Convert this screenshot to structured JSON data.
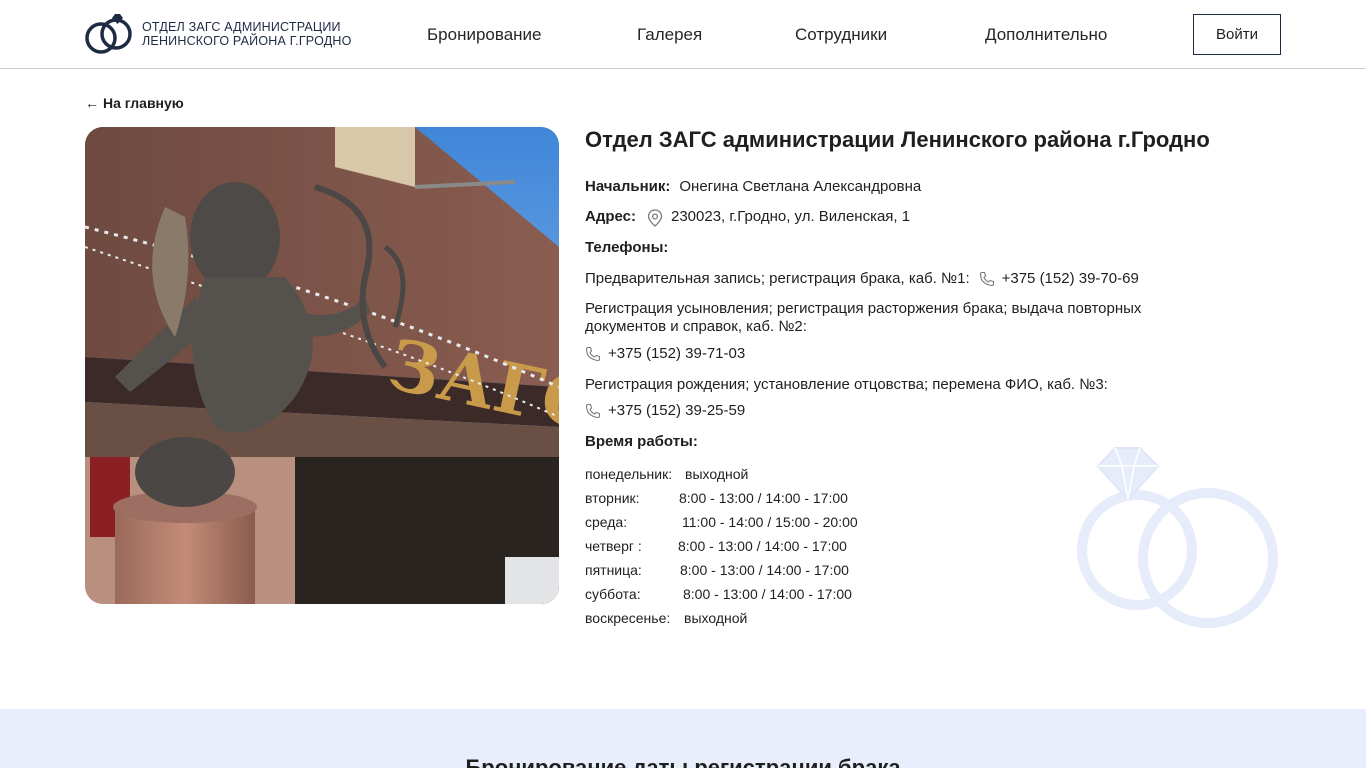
{
  "header": {
    "logo_line1": "ОТДЕЛ ЗАГС АДМИНИСТРАЦИИ",
    "logo_line2": "ЛЕНИНСКОГО РАЙОНА Г.ГРОДНО",
    "nav": [
      "Бронирование",
      "Галерея",
      "Сотрудники",
      "Дополнительно"
    ],
    "login_label": "Войти"
  },
  "back_link": "На главную",
  "main": {
    "title": "Отдел ЗАГС администрации Ленинского района г.Гродно",
    "head_label": "Начальник:",
    "head_value": "Онегина Светлана Александровна",
    "address_label": "Адрес:",
    "address_value": "230023, г.Гродно, ул. Виленская, 1",
    "phones_label": "Телефоны:",
    "phone1_desc": "Предварительная запись; регистрация брака, каб. №1:",
    "phone1": "+375 (152) 39-70-69",
    "phone2_desc_line1": "Регистрация усыновления; регистрация расторжения брака; выдача повторных",
    "phone2_desc_line2": "документов и справок, каб. №2:",
    "phone2": "+375 (152) 39-71-03",
    "phone3_desc": "Регистрация рождения; установление отцовства; перемена ФИО, каб. №3:",
    "phone3": "+375 (152) 39-25-59",
    "hours_label": "Время работы:",
    "schedule": [
      {
        "day": "понедельник:",
        "hours": "выходной"
      },
      {
        "day": "вторник:",
        "hours": "8:00 - 13:00 / 14:00 - 17:00"
      },
      {
        "day": "среда:",
        "hours": "11:00 - 14:00 / 15:00 - 20:00"
      },
      {
        "day": "четверг :",
        "hours": "8:00 - 13:00 / 14:00 - 17:00"
      },
      {
        "day": "пятница:",
        "hours": "8:00 - 13:00 / 14:00 - 17:00"
      },
      {
        "day": "суббота:",
        "hours": "8:00 - 13:00 / 14:00 - 17:00"
      },
      {
        "day": "воскресенье:",
        "hours": "выходной"
      }
    ]
  },
  "band": {
    "title": "Бронирование даты регистрации брака"
  },
  "colors": {
    "brand": "#1f2a44",
    "band_bg": "#e8eefc",
    "rings": "#e6ecfa"
  }
}
